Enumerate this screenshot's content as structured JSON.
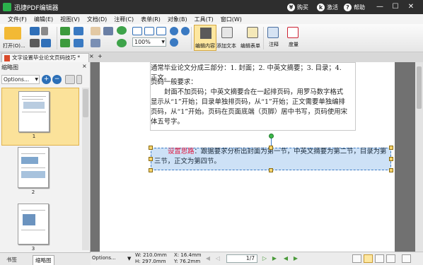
{
  "window": {
    "title": "迅捷PDF编辑器",
    "actions": [
      {
        "icon": "cart-icon",
        "label": "购买"
      },
      {
        "icon": "key-icon",
        "label": "激活"
      },
      {
        "icon": "help-icon",
        "label": "帮助"
      }
    ]
  },
  "menu": [
    "文件(F)",
    "编辑(E)",
    "视图(V)",
    "文档(D)",
    "注释(C)",
    "表单(R)",
    "对象(B)",
    "工具(T)",
    "窗口(W)"
  ],
  "toolbar": {
    "open_label": "打开(O)...",
    "zoom_value": "100%",
    "edit_content_label": "编辑内容",
    "add_text_label": "添加文本",
    "edit_form_label": "编辑表单",
    "comment_label": "注释",
    "measure_label": "度量"
  },
  "tab": {
    "doc_name": "文字设置毕业论文页码技巧 *",
    "close": "×",
    "add": "+"
  },
  "left_panel": {
    "title": "缩略图",
    "options_label": "Options...",
    "thumbnails": [
      {
        "num": "1"
      },
      {
        "num": "2"
      },
      {
        "num": "3"
      }
    ],
    "bottom_tabs": [
      "书签",
      "缩略图"
    ]
  },
  "document": {
    "paragraphs": [
      "通常毕业论文分成三部分：1. 封面；2. 中英文摘要；3. 目录；4. 正文。",
      "页码一般要求：",
      "封面不加页码；中英文摘要合在一起排页码，用罗马数字格式显示从“1”开始；目录单独排页码，从“1”开始；正文需要单独编排页码，从“1”开始。页码在页面底端（页脚）居中书写，页码使用宋体五号字。"
    ],
    "selected_highlight": "设置思路",
    "selected_text": "：跟据要求分析出封面为第一节，中英文摘要为第二节，目录为第三节，正文为第四节。"
  },
  "status": {
    "options_label": "Options...",
    "width_label": "W: 210.0mm",
    "height_label": "H: 297.0mm",
    "x_label": "X: 16.4mm",
    "y_label": "Y: 76.2mm",
    "page_indicator": "1/7"
  }
}
